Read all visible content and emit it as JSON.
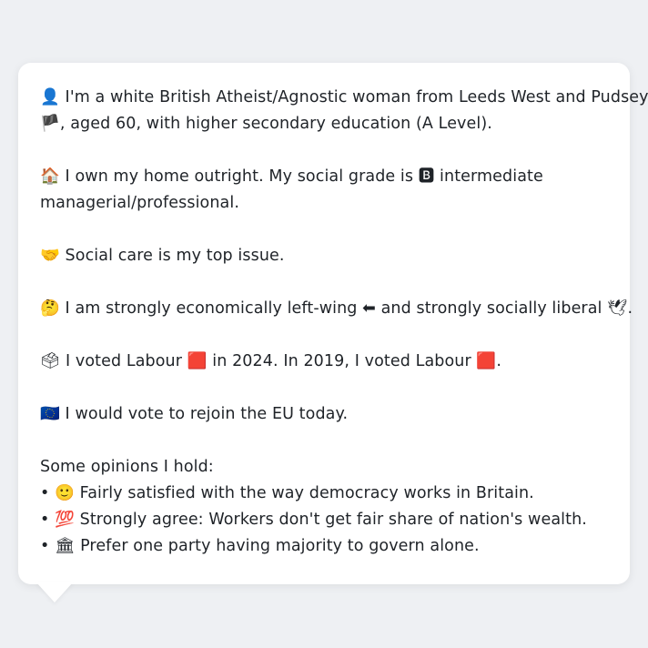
{
  "profile": {
    "p1_line1": "👤 I'm a white British Atheist/Agnostic woman from Leeds West and Pudsey",
    "p1_line2": "🏴, aged 60, with higher secondary education (A Level).",
    "p2_line1": "🏠 I own my home outright. My social grade is 🅱 intermediate",
    "p2_line2": "managerial/professional.",
    "p3": "🤝 Social care is my top issue.",
    "p4": "🤔 I am strongly economically left-wing ⬅ and strongly socially liberal 🕊.",
    "p5": "🗳 I voted Labour 🟥 in 2024. In 2019, I voted Labour 🟥.",
    "p6": "🇪🇺 I would vote to rejoin the EU today."
  },
  "opinions": {
    "heading": "Some opinions I hold:",
    "items": [
      "• 🙂 Fairly satisfied with the way democracy works in Britain.",
      "• 💯 Strongly agree: Workers don't get fair share of nation's wealth.",
      "• 🏛 Prefer one party having majority to govern alone."
    ]
  }
}
